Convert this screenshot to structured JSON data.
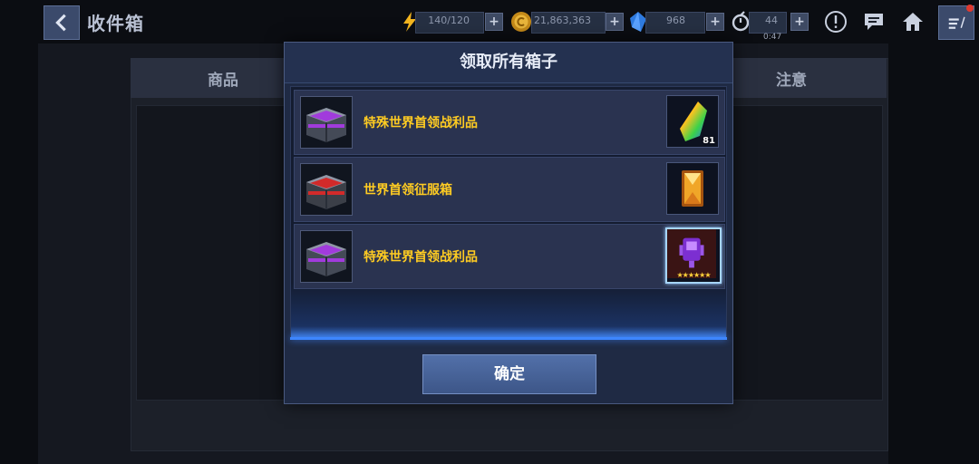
{
  "header": {
    "title": "收件箱",
    "energy": "140/120",
    "gold": "21,863,363",
    "crystals": "968",
    "stamina": "44",
    "stamina_timer": "0:47"
  },
  "background": {
    "col_goods": "商品",
    "col_notice": "注意"
  },
  "modal": {
    "title": "领取所有箱子",
    "items": [
      {
        "label": "特殊世界首领战利品",
        "chest_color": "#a13bdc",
        "reward": "rainbow-crystal-icon",
        "count": "81"
      },
      {
        "label": "世界首领征服箱",
        "chest_color": "#d22a2a",
        "reward": "gold-gem-icon",
        "count": ""
      },
      {
        "label": "特殊世界首领战利品",
        "chest_color": "#a13bdc",
        "reward": "purple-module-icon",
        "stars": "★★★★★★"
      }
    ],
    "confirm_label": "确定"
  }
}
